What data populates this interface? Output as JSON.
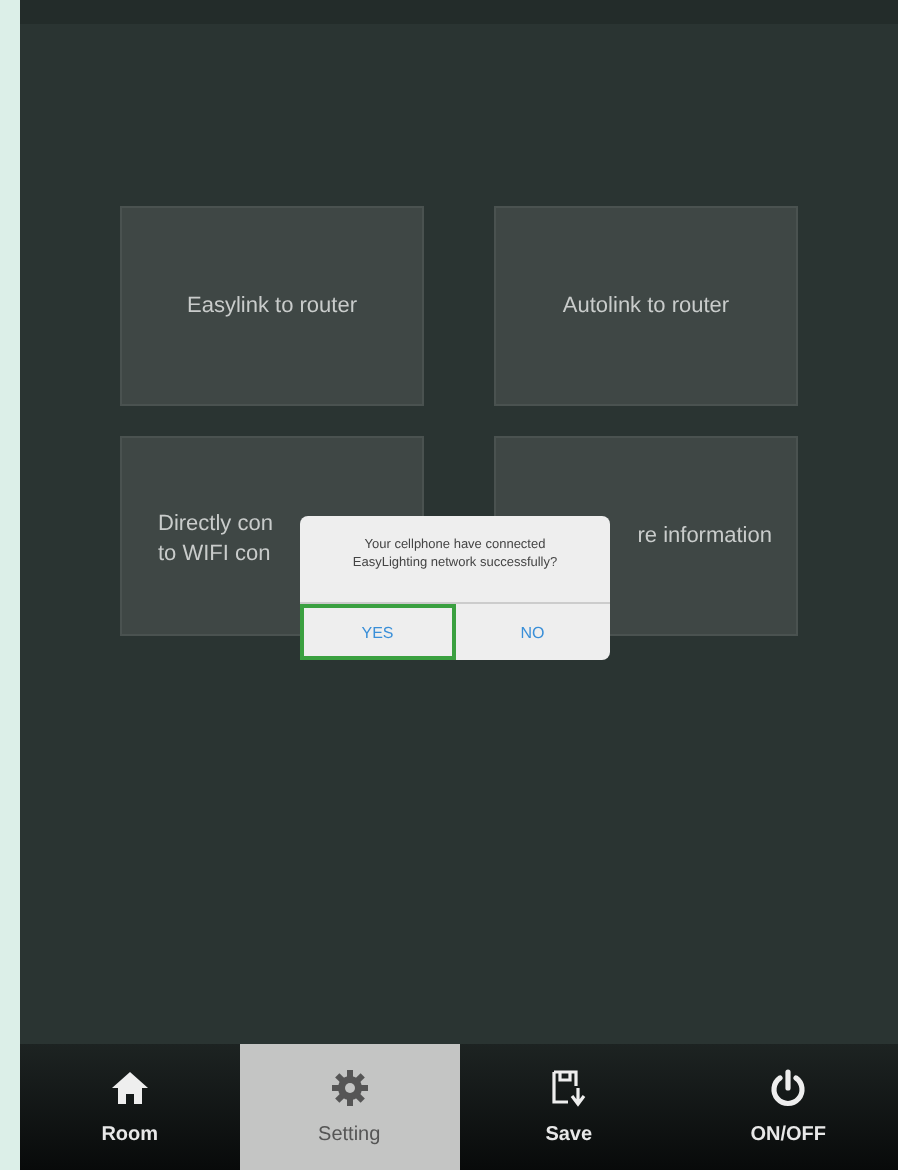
{
  "tiles": [
    {
      "label": "Easylink to router"
    },
    {
      "label": "Autolink to router"
    },
    {
      "label": "Directly con\nto WIFI con",
      "kind": "covered-right"
    },
    {
      "label": "re information",
      "kind": "covered-left"
    }
  ],
  "dialog": {
    "message": "Your cellphone have connected\nEasyLighting network successfully?",
    "buttons": [
      {
        "label": "YES",
        "selected": true
      },
      {
        "label": "NO",
        "selected": false
      }
    ]
  },
  "tabs": [
    {
      "label": "Room",
      "kind": "home",
      "selected": false
    },
    {
      "label": "Setting",
      "kind": "gear",
      "selected": true
    },
    {
      "label": "Save",
      "kind": "save",
      "selected": false
    },
    {
      "label": "ON/OFF",
      "kind": "power",
      "selected": false
    }
  ]
}
